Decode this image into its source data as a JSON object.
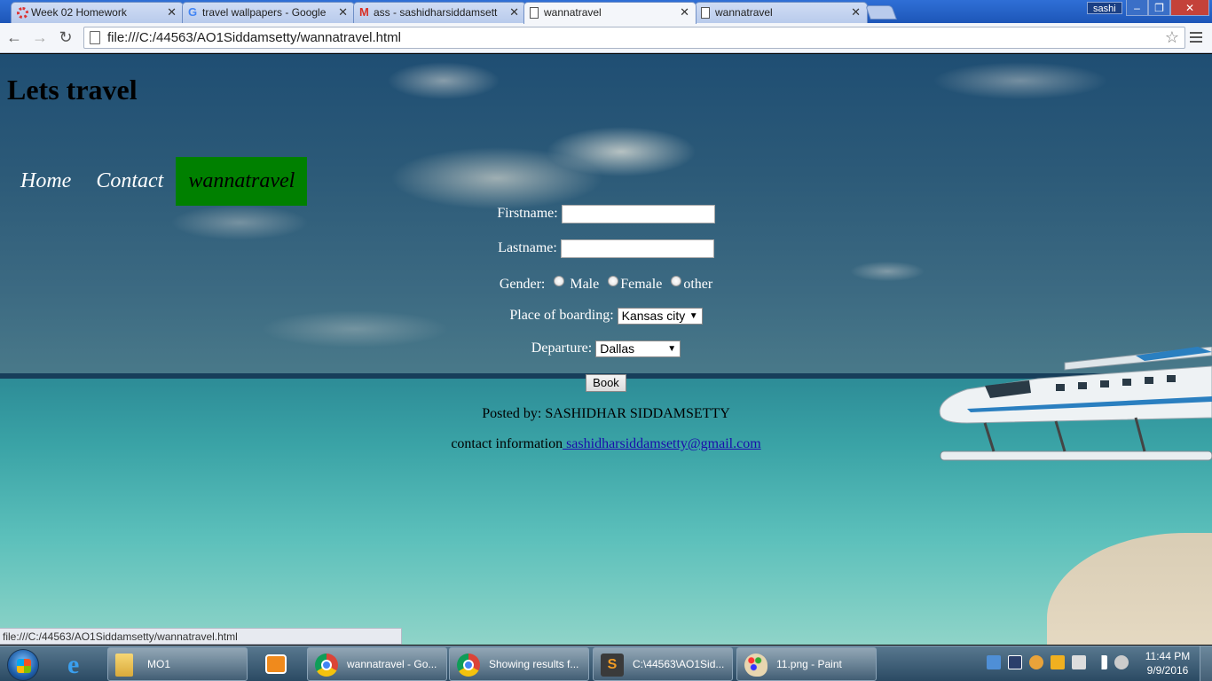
{
  "browser": {
    "tabs": [
      {
        "title": "Week 02 Homework",
        "icon": "red-ring-icon",
        "active": false
      },
      {
        "title": "travel wallpapers - Google",
        "icon": "google-g-icon",
        "active": false
      },
      {
        "title": "ass - sashidharsiddamsett",
        "icon": "gmail-icon",
        "active": false
      },
      {
        "title": "wannatravel",
        "icon": "page-icon",
        "active": true
      },
      {
        "title": "wannatravel",
        "icon": "page-icon",
        "active": false
      }
    ],
    "user_badge": "sashi",
    "url": "file:///C:/44563/AO1Siddamsetty/wannatravel.html",
    "status_url": "file:///C:/44563/AO1Siddamsetty/wannatravel.html",
    "window_buttons": {
      "minimize": "–",
      "maximize": "❐",
      "close": "✕"
    }
  },
  "page": {
    "title": "Lets travel",
    "nav": [
      {
        "label": "Home",
        "active": false
      },
      {
        "label": "Contact",
        "active": false
      },
      {
        "label": "wannatravel",
        "active": true
      }
    ],
    "form": {
      "firstname_label": "Firstname:",
      "firstname_value": "",
      "lastname_label": "Lastname:",
      "lastname_value": "",
      "gender_label": "Gender:",
      "gender_options": [
        "Male",
        "Female",
        "other"
      ],
      "boarding_label": "Place of boarding:",
      "boarding_value": "Kansas city",
      "departure_label": "Departure:",
      "departure_value": "Dallas",
      "book_label": "Book"
    },
    "posted_by": "Posted by: SASHIDHAR SIDDAMSETTY",
    "contact_label": "contact information",
    "contact_email": " sashidharsiddamsetty@gmail.com",
    "colors": {
      "nav_active_bg": "#008000",
      "link": "#1a0dab"
    }
  },
  "taskbar": {
    "tasks": [
      {
        "label": "MO1",
        "icon": "folder-icon"
      },
      {
        "label": "wannatravel - Go...",
        "icon": "chrome-icon"
      },
      {
        "label": "Showing results f...",
        "icon": "chrome-icon"
      },
      {
        "label": "C:\\44563\\AO1Sid...",
        "icon": "sublime-text-icon"
      },
      {
        "label": "11.png - Paint",
        "icon": "paint-icon"
      }
    ],
    "clock_time": "11:44 PM",
    "clock_date": "9/9/2016"
  }
}
